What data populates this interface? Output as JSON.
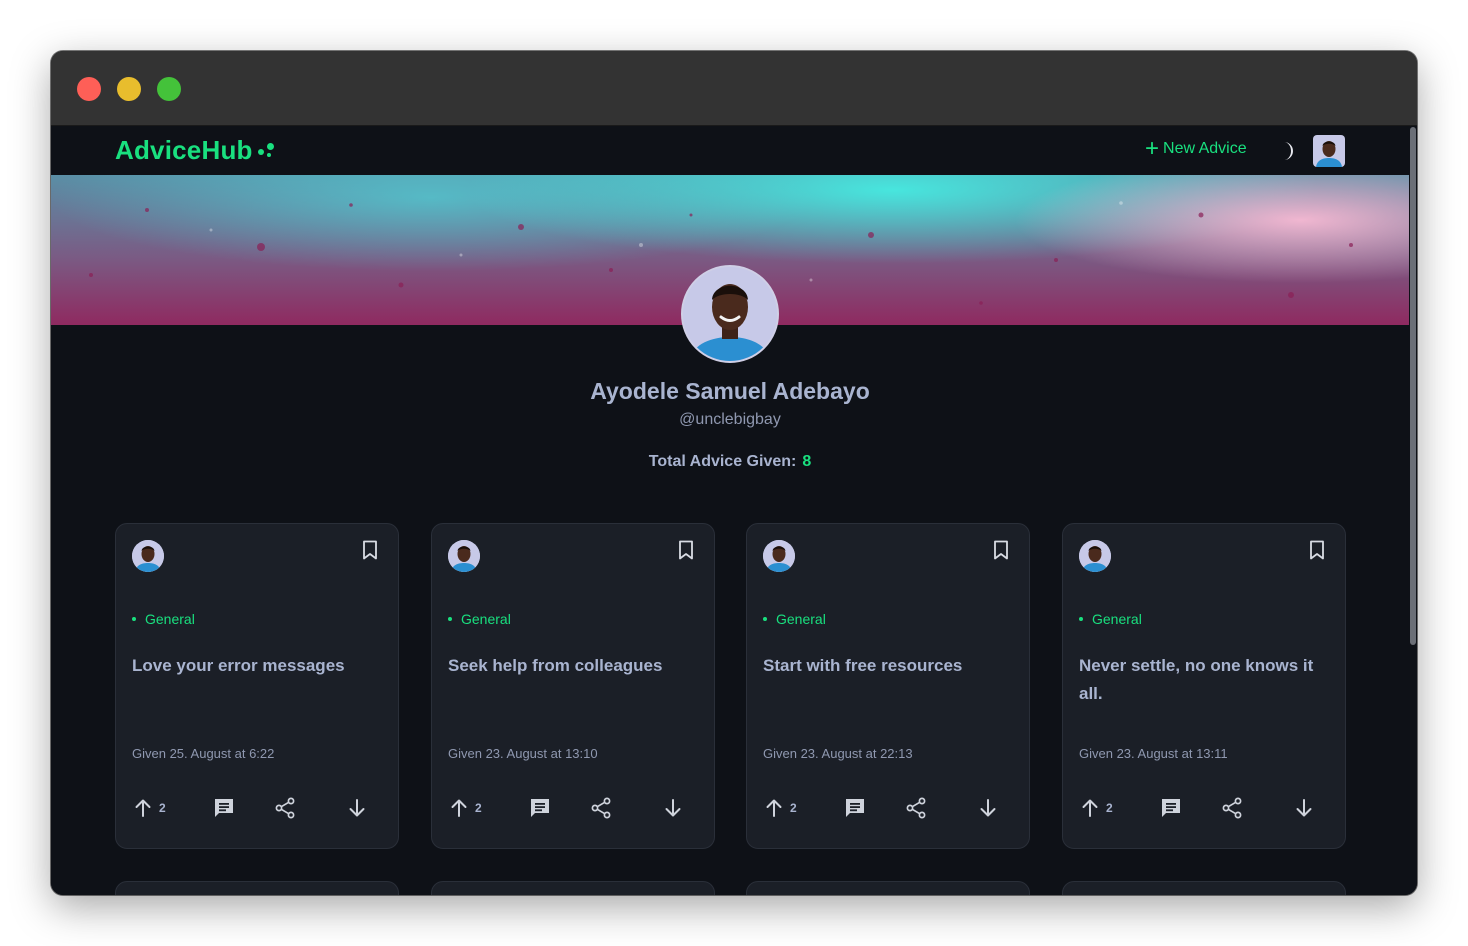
{
  "app": {
    "name": "AdviceHub",
    "accent": "#19e07f"
  },
  "nav": {
    "new_advice_label": "New Advice",
    "theme_toggle_icon": "moon-icon",
    "avatar_icon": "user-avatar"
  },
  "profile": {
    "name": "Ayodele Samuel Adebayo",
    "handle": "@unclebigbay",
    "total_label": "Total Advice Given:",
    "total_count": "8"
  },
  "cards": [
    {
      "tag": "General",
      "title": "Love your error messages",
      "given": "Given 25. August at 6:22",
      "upvotes": "2"
    },
    {
      "tag": "General",
      "title": "Seek help from colleagues",
      "given": "Given 23. August at 13:10",
      "upvotes": "2"
    },
    {
      "tag": "General",
      "title": "Start with free resources",
      "given": "Given 23. August at 22:13",
      "upvotes": "2"
    },
    {
      "tag": "General",
      "title": "Never settle, no one knows it all.",
      "given": "Given 23. August at 13:11",
      "upvotes": "2"
    }
  ],
  "icons": {
    "bookmark": "bookmark-icon",
    "upvote": "arrow-up-icon",
    "comment": "comment-icon",
    "share": "share-icon",
    "downvote": "arrow-down-icon"
  }
}
